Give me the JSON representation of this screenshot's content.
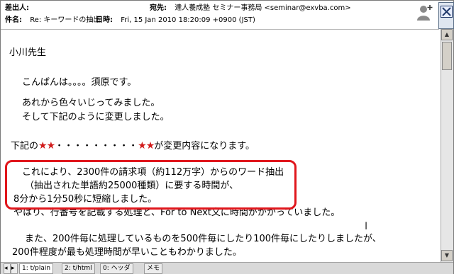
{
  "header": {
    "from_label": "差出人:",
    "from_value": "",
    "to_label": "宛先:",
    "to_value": "達人養成塾 セミナー事務局 <seminar@exvba.com>",
    "subject_label": "件名:",
    "subject_value": "Re: キーワードの抽出",
    "date_label": "日時:",
    "date_value": "Fri, 15 Jan 2010 18:20:09 +0900 (JST)"
  },
  "body": {
    "line1": "小川先生",
    "line2": "こんばんは。。。。須原です。",
    "line3": "あれから色々いじってみました。",
    "line4": "そして下記のように変更しました。",
    "line5a": "下記の",
    "line5stars1": "★★",
    "line5dots": "・・・・・・・・・",
    "line5stars2": "★★",
    "line5b": "が変更内容になります。",
    "line6": "これにより、2300件の請求項（約112万字）からのワード抽出",
    "line7": "（抽出された単語約25000種類）に要する時間が、",
    "line8": "8分から1分50秒に短縮しました。",
    "line9": "やはり、行番号を記載する処理と、For to Next文に時間がかかっていました。",
    "line10": "また、200件毎に処理しているものを500件毎にしたり100件毎にしたりしましたが、",
    "line11": "200件程度が最も処理時間が早いこともわかりました。"
  },
  "tabs": [
    {
      "label": "1: t/plain"
    },
    {
      "label": "2: t/html"
    },
    {
      "label": "0: ヘッダ"
    },
    {
      "label": "メモ"
    }
  ],
  "colors": {
    "highlight": "#e0161c",
    "star": "#d11b1b"
  }
}
